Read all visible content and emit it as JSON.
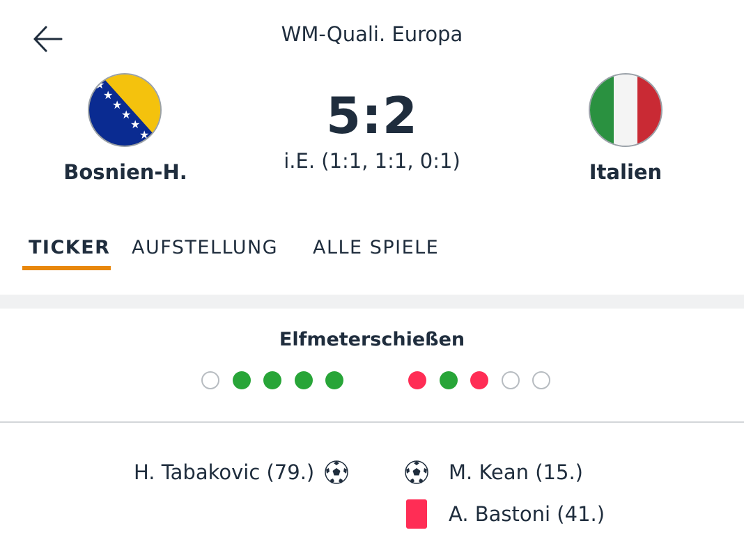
{
  "header": {
    "title": "WM-Quali. Europa",
    "back_icon": "arrow-left-icon"
  },
  "match": {
    "home": {
      "name": "Bosnien-H.",
      "flag": "bosnia-flag-icon"
    },
    "away": {
      "name": "Italien",
      "flag": "italy-flag-icon"
    },
    "score": "5:2",
    "score_detail": "i.E. (1:1, 1:1, 0:1)"
  },
  "tabs": [
    {
      "label": "TICKER",
      "active": true
    },
    {
      "label": "AUFSTELLUNG",
      "active": false
    },
    {
      "label": "ALLE SPIELE",
      "active": false
    }
  ],
  "shootout": {
    "title": "Elfmeterschießen",
    "home": [
      "pending",
      "scored",
      "scored",
      "scored",
      "scored"
    ],
    "away": [
      "missed",
      "scored",
      "missed",
      "pending",
      "pending"
    ]
  },
  "events": {
    "home": [
      {
        "text": "H. Tabakovic (79.)",
        "icon": "soccer-ball-icon"
      }
    ],
    "away": [
      {
        "text": "M. Kean (15.)",
        "icon": "soccer-ball-icon"
      },
      {
        "text": "A. Bastoni (41.)",
        "icon": "red-card-icon"
      }
    ]
  },
  "colors": {
    "accent": "#e8870c",
    "scored": "#28a538",
    "missed": "#ff2d55",
    "text": "#1f2d3d"
  }
}
